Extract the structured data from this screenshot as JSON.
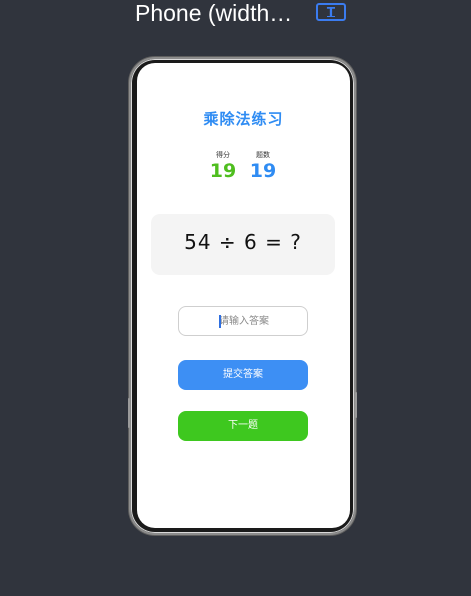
{
  "header": {
    "device_label": "Phone (width…",
    "text_toggle_icon": "T"
  },
  "app": {
    "title": "乘除法练习",
    "score": {
      "label": "得分",
      "value": "19"
    },
    "count": {
      "label": "题数",
      "value": "19"
    },
    "question": "54 ÷ 6 = ?",
    "answer_input": {
      "value": "",
      "placeholder": "请输入答案"
    },
    "submit_label": "提交答案",
    "next_label": "下一题"
  },
  "colors": {
    "accent_blue": "#2f8cf3",
    "score_green": "#4fbe1f",
    "submit_button": "#3d8ff4",
    "next_button": "#3ec81f",
    "background": "#30343d"
  }
}
